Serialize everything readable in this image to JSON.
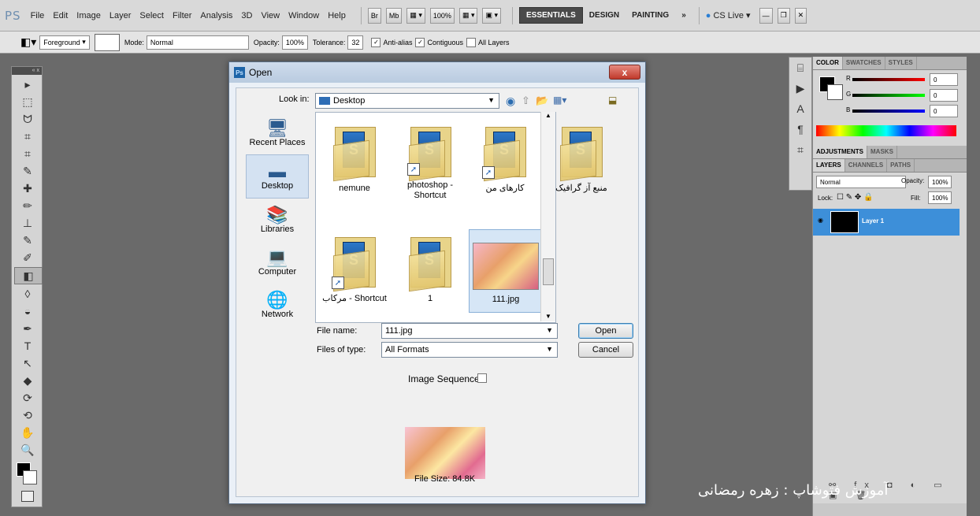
{
  "menubar": {
    "logo": "PS",
    "items": [
      "File",
      "Edit",
      "Image",
      "Layer",
      "Select",
      "Filter",
      "Analysis",
      "3D",
      "View",
      "Window",
      "Help"
    ],
    "mini_br": "Br",
    "mini_mb": "Mb",
    "zoom": "100%",
    "workspaces": [
      "ESSENTIALS",
      "DESIGN",
      "PAINTING"
    ],
    "more": "»",
    "cslive": "CS Live"
  },
  "options": {
    "fill_source": "Foreground",
    "mode_label": "Mode:",
    "mode_value": "Normal",
    "opacity_label": "Opacity:",
    "opacity_value": "100%",
    "tolerance_label": "Tolerance:",
    "tolerance_value": "32",
    "antialias_label": "Anti-alias",
    "contiguous_label": "Contiguous",
    "all_layers_label": "All Layers"
  },
  "tools_panel": {
    "header": "«  x",
    "icons": [
      "move-icon",
      "marquee-icon",
      "lasso-icon",
      "quick-select-icon",
      "crop-icon",
      "eyedropper-icon",
      "healing-icon",
      "brush-icon",
      "stamp-icon",
      "history-brush-icon",
      "eraser-icon",
      "paint-bucket-icon",
      "blur-icon",
      "dodge-icon",
      "pen-icon",
      "type-icon",
      "path-select-icon",
      "shape-icon",
      "3d-rotate-icon",
      "3d-orbit-icon",
      "hand-icon",
      "zoom-icon"
    ],
    "glyphs": [
      "▸",
      "⬚",
      "ᗢ",
      "⌗",
      "⌗",
      "✎",
      "✚",
      "✏",
      "⊥",
      "✎",
      "✐",
      "◧",
      "◊",
      "◒",
      "✒",
      "T",
      "↖",
      "◆",
      "⟳",
      "⟲",
      "✋",
      "🔍"
    ],
    "selected_index": 11
  },
  "color_panel": {
    "tabs": [
      "COLOR",
      "SWATCHES",
      "STYLES"
    ],
    "r_label": "R",
    "r_value": "0",
    "g_label": "G",
    "g_value": "0",
    "b_label": "B",
    "b_value": "0"
  },
  "adjust_panel": {
    "tabs": [
      "ADJUSTMENTS",
      "MASKS"
    ]
  },
  "layers_panel": {
    "tabs": [
      "LAYERS",
      "CHANNELS",
      "PATHS"
    ],
    "blend": "Normal",
    "opacity_label": "Opacity:",
    "opacity_value": "100%",
    "lock_label": "Lock:",
    "fill_label": "Fill:",
    "fill_value": "100%",
    "layer_name": "Layer 1"
  },
  "dialog": {
    "title": "Open",
    "ps_icon": "Ps",
    "close": "x",
    "look_in_label": "Look in:",
    "look_in_value": "Desktop",
    "places": [
      "Recent Places",
      "Desktop",
      "Libraries",
      "Computer",
      "Network"
    ],
    "files": [
      {
        "name": "nemune",
        "kind": "folder"
      },
      {
        "name": "photoshop - Shortcut",
        "kind": "folder"
      },
      {
        "name": "کارهای من",
        "kind": "folder"
      },
      {
        "name": "منبع آز گرافیک",
        "kind": "folder"
      },
      {
        "name": "مرکاب - Shortcut",
        "kind": "folder"
      },
      {
        "name": "1",
        "kind": "folder"
      },
      {
        "name": "111.jpg",
        "kind": "image"
      }
    ],
    "file_name_label": "File name:",
    "file_name_value": "111.jpg",
    "file_type_label": "Files of type:",
    "file_type_value": "All Formats",
    "open_button": "Open",
    "cancel_button": "Cancel",
    "image_sequence_label": "Image Sequence",
    "file_size": "File Size: 84.8K"
  },
  "watermark": "آموزش فتوشاپ : زهره رمضانی",
  "colors": {
    "selection_blue": "#3d8fd9",
    "dialog_bg": "#eaf0f7",
    "close_red": "#c0392b"
  }
}
